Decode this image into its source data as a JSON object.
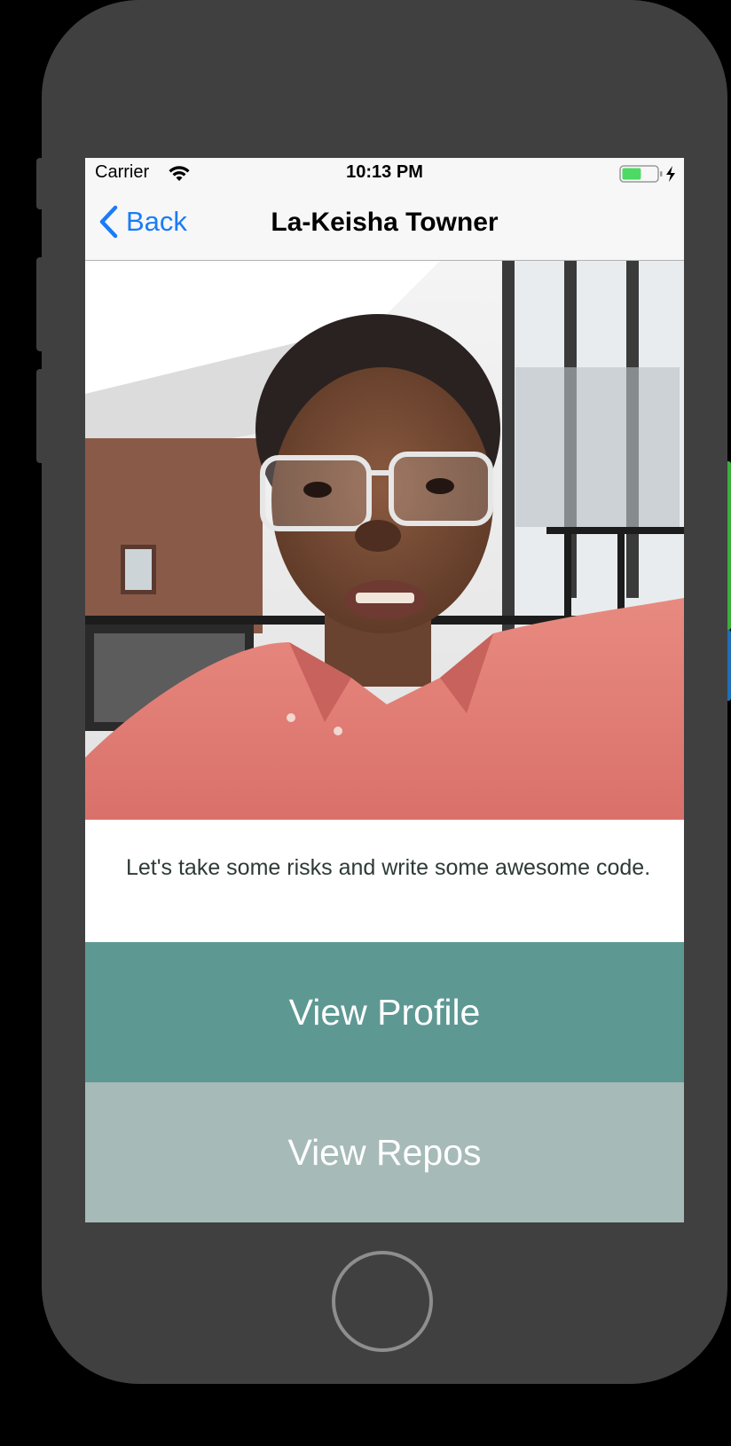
{
  "status_bar": {
    "carrier": "Carrier",
    "time": "10:13 PM",
    "wifi_icon": "wifi-icon",
    "battery_icon": "battery-charging-icon",
    "battery_level": 0.55
  },
  "nav": {
    "back_label": "Back",
    "back_icon": "chevron-left-icon",
    "title": "La-Keisha Towner"
  },
  "profile": {
    "bio": "Let's take some risks and write some awesome code."
  },
  "actions": {
    "view_profile_label": "View Profile",
    "view_repos_label": "View Repos"
  },
  "colors": {
    "tint": "#1a7cf6",
    "primary_button": "#5e9893",
    "secondary_button": "#a6bab8",
    "device_frame": "#404040"
  }
}
